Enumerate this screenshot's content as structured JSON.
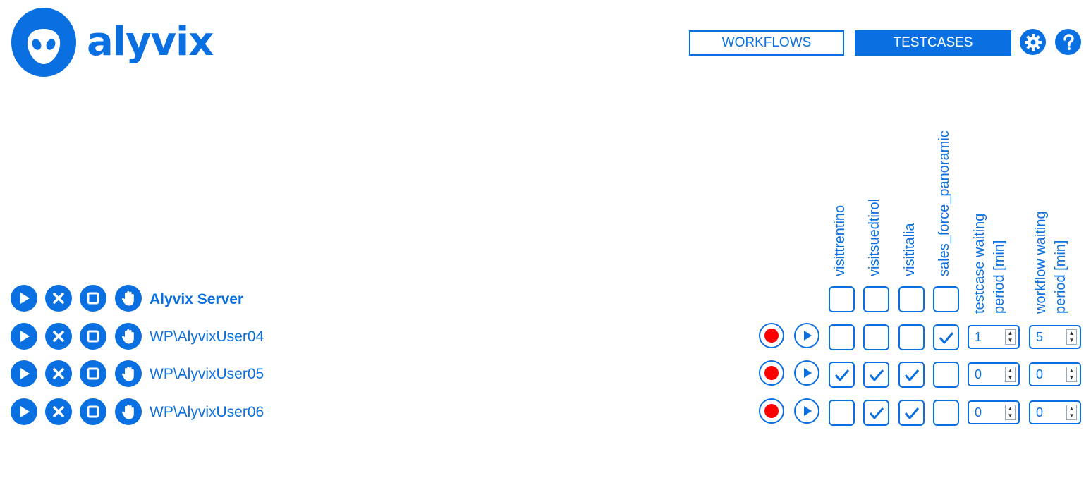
{
  "app": {
    "logo_text": "alyvix"
  },
  "nav": {
    "workflows_label": "WORKFLOWS",
    "testcases_label": "TESTCASES"
  },
  "icons": {
    "settings": "gear-icon",
    "help": "help-icon",
    "run": "play-icon",
    "abort": "close-icon",
    "stop": "stop-icon",
    "hold": "hand-icon",
    "record": "record-icon",
    "play_outline": "play-outline-icon"
  },
  "colors": {
    "accent": "#0a6fe0",
    "record": "#ff0000",
    "background": "#ffffff"
  },
  "columns": {
    "testcases": [
      "visittrentino",
      "visitsuedtirol",
      "visititalia",
      "sales_force_panoramic"
    ],
    "testcase_wait_line1": "testcase waiting",
    "testcase_wait_line2": "period [min]",
    "workflow_wait_line1": "workflow waiting",
    "workflow_wait_line2": "period [min]"
  },
  "server": {
    "label": "Alyvix Server",
    "checks": [
      false,
      false,
      false,
      false
    ]
  },
  "rows": [
    {
      "label": "WP\\AlyvixUser04",
      "checks": [
        false,
        false,
        false,
        true
      ],
      "testcase_wait": "1",
      "workflow_wait": "5"
    },
    {
      "label": "WP\\AlyvixUser05",
      "checks": [
        true,
        true,
        true,
        false
      ],
      "testcase_wait": "0",
      "workflow_wait": "0"
    },
    {
      "label": "WP\\AlyvixUser06",
      "checks": [
        false,
        true,
        true,
        false
      ],
      "testcase_wait": "0",
      "workflow_wait": "0"
    }
  ]
}
